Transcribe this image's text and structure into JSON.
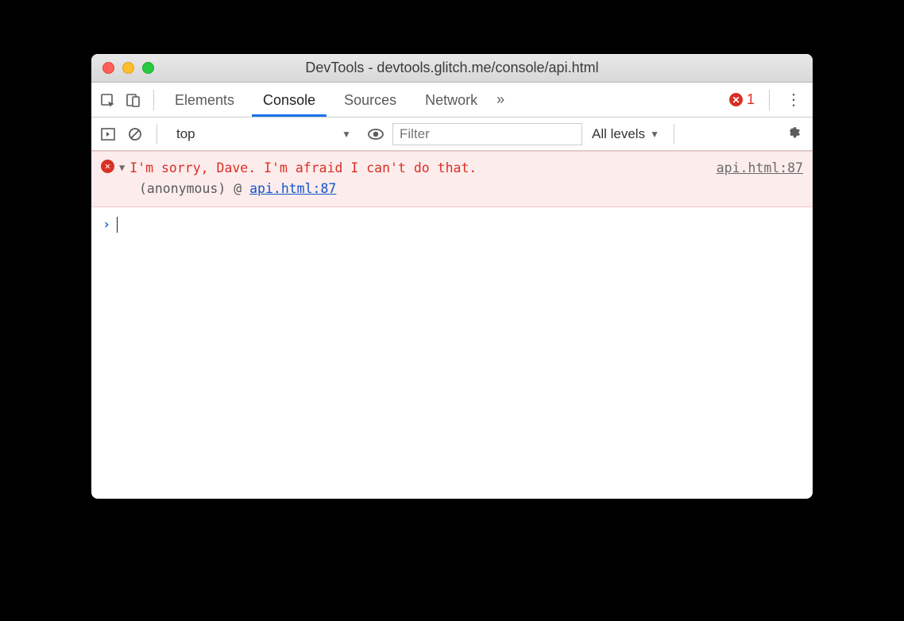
{
  "window": {
    "title": "DevTools - devtools.glitch.me/console/api.html"
  },
  "tabbar": {
    "tabs": [
      "Elements",
      "Console",
      "Sources",
      "Network"
    ],
    "active_index": 1,
    "more_glyph": "»",
    "error_count": "1"
  },
  "filterbar": {
    "context": "top",
    "filter_placeholder": "Filter",
    "levels_label": "All levels"
  },
  "console": {
    "error": {
      "message": "I'm sorry, Dave. I'm afraid I can't do that.",
      "source_link": "api.html:87",
      "stack_prefix": "(anonymous) @ ",
      "stack_link": "api.html:87"
    },
    "prompt_glyph": "›"
  }
}
